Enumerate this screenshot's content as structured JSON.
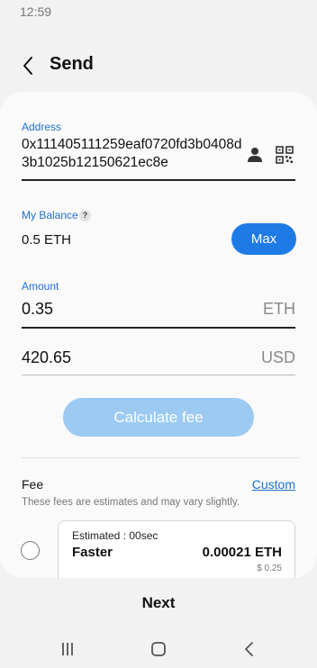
{
  "status_bar": {
    "time": "12:59"
  },
  "header": {
    "title": "Send"
  },
  "address": {
    "label": "Address",
    "value": "0x111405111259eaf0720fd3b0408d3b1025b12150621ec8e"
  },
  "balance": {
    "label": "My Balance",
    "info_icon_glyph": "?",
    "value": "0.5 ETH",
    "max_label": "Max"
  },
  "amount": {
    "label": "Amount",
    "eth_value": "0.35",
    "eth_unit": "ETH",
    "usd_value": "420.65",
    "usd_unit": "USD"
  },
  "calculate_label": "Calculate fee",
  "fee": {
    "title": "Fee",
    "custom_label": "Custom",
    "note": "These fees are estimates and may vary slightly.",
    "option": {
      "estimated": "Estimated : 00sec",
      "speed": "Faster",
      "eth_amount": "0.00021 ETH",
      "usd_amount": "$ 0.25",
      "selected": false
    }
  },
  "next_label": "Next",
  "icons": {
    "back": "back-arrow-icon",
    "contact": "contact-person-icon",
    "qr": "qr-code-icon",
    "info": "info-icon",
    "nav_recents": "recents-icon",
    "nav_home": "home-icon",
    "nav_back": "nav-back-icon"
  },
  "colors": {
    "accent": "#1e7be6",
    "label_blue": "#1f6fcc",
    "disabled_button": "#9ccaf2"
  }
}
